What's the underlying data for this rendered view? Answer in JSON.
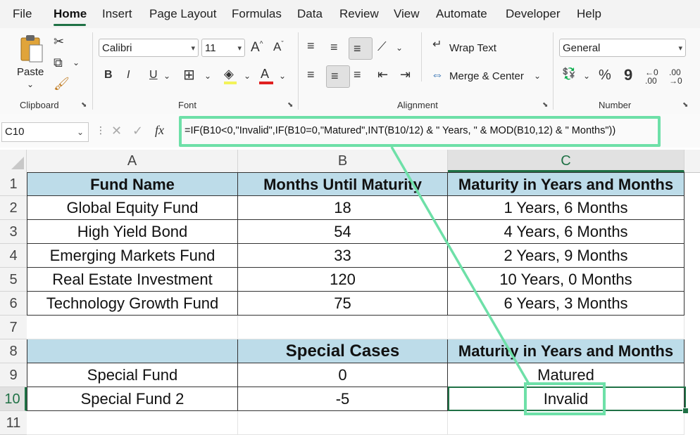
{
  "menu": {
    "items": [
      "File",
      "Home",
      "Insert",
      "Page Layout",
      "Formulas",
      "Data",
      "Review",
      "View",
      "Automate",
      "Developer",
      "Help"
    ],
    "active": "Home"
  },
  "ribbon": {
    "clipboard": {
      "paste_label": "Paste",
      "group_label": "Clipboard"
    },
    "font": {
      "font_name": "Calibri",
      "font_size": "11",
      "group_label": "Font",
      "bold": "B",
      "italic": "I",
      "underline": "U"
    },
    "alignment": {
      "wrap_text": "Wrap Text",
      "merge_center": "Merge & Center",
      "group_label": "Alignment"
    },
    "number": {
      "format": "General",
      "group_label": "Number",
      "percent": "%",
      "comma": "9"
    }
  },
  "formula_bar": {
    "name_box": "C10",
    "fx": "fx",
    "formula": "=IF(B10<0,\"Invalid\",IF(B10=0,\"Matured\",INT(B10/12) & \" Years, \" & MOD(B10,12) & \" Months\"))"
  },
  "sheet": {
    "columns": [
      "A",
      "B",
      "C"
    ],
    "rows": [
      {
        "n": "1",
        "a": "Fund Name",
        "b": "Months Until Maturity",
        "c": "Maturity in Years and Months"
      },
      {
        "n": "2",
        "a": "Global Equity Fund",
        "b": "18",
        "c": "1 Years, 6 Months"
      },
      {
        "n": "3",
        "a": "High Yield Bond",
        "b": "54",
        "c": "4 Years, 6 Months"
      },
      {
        "n": "4",
        "a": "Emerging Markets Fund",
        "b": "33",
        "c": "2 Years, 9 Months"
      },
      {
        "n": "5",
        "a": "Real Estate Investment",
        "b": "120",
        "c": "10 Years, 0 Months"
      },
      {
        "n": "6",
        "a": "Technology Growth Fund",
        "b": "75",
        "c": "6 Years, 3 Months"
      },
      {
        "n": "7",
        "a": "",
        "b": "",
        "c": ""
      },
      {
        "n": "8",
        "a": "",
        "b": "Special Cases",
        "c": "Maturity in Years and Months"
      },
      {
        "n": "9",
        "a": "Special Fund",
        "b": "0",
        "c": "Matured"
      },
      {
        "n": "10",
        "a": "Special Fund 2",
        "b": "-5",
        "c": "Invalid"
      },
      {
        "n": "11",
        "a": "",
        "b": "",
        "c": ""
      }
    ]
  },
  "colors": {
    "header_fill": "#bddce9",
    "accent": "#1f7145",
    "highlight": "#6ee0a8"
  }
}
